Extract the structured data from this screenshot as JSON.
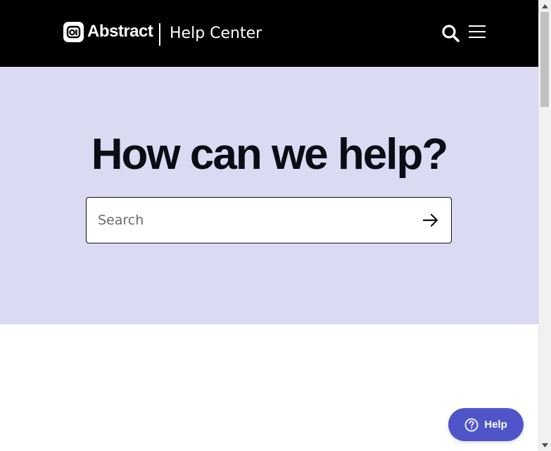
{
  "header": {
    "brand_name": "Abstract",
    "section_title": "Help Center",
    "background_color": "#000000",
    "icons": [
      "abstract-logo-icon",
      "search-icon",
      "hamburger-menu-icon"
    ]
  },
  "hero": {
    "title": "How can we help?",
    "background_color": "#dadaf2",
    "search": {
      "placeholder": "Search",
      "value": ""
    }
  },
  "content": {
    "partial_heading": ""
  },
  "help_widget": {
    "label": "Help",
    "color": "#4f55c9"
  }
}
